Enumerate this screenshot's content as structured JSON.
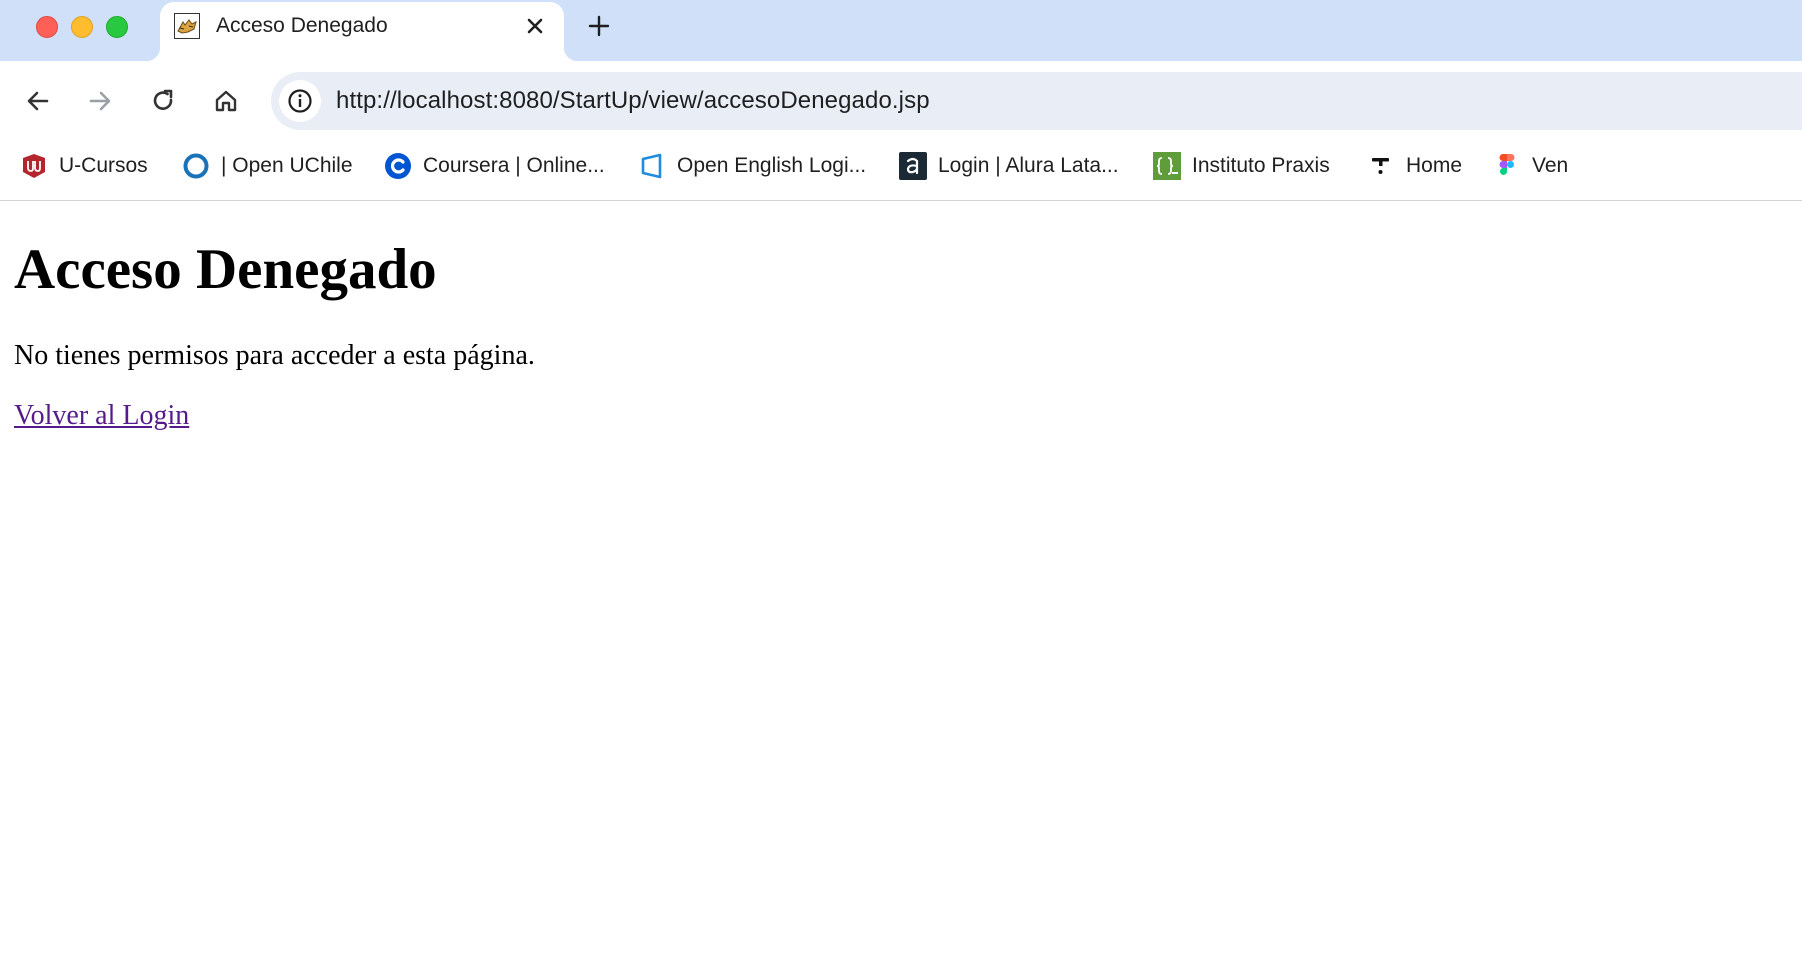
{
  "browser": {
    "tab": {
      "title": "Acceso Denegado",
      "favicon": "tomcat-icon"
    },
    "address_bar": {
      "url": "http://localhost:8080/StartUp/view/accesoDenegado.jsp"
    },
    "bookmarks": [
      {
        "label": "U-Cursos",
        "icon": "u-cursos-icon"
      },
      {
        "label": "| Open UChile",
        "icon": "open-uchile-icon"
      },
      {
        "label": "Coursera | Online...",
        "icon": "coursera-icon"
      },
      {
        "label": "Open English Logi...",
        "icon": "open-english-icon"
      },
      {
        "label": "Login | Alura Lata...",
        "icon": "alura-icon"
      },
      {
        "label": "Instituto Praxis",
        "icon": "praxis-icon"
      },
      {
        "label": "Home",
        "icon": "home-bookmark-icon"
      },
      {
        "label": "Ven",
        "icon": "figma-icon"
      }
    ],
    "colors": {
      "tabstrip": "#cfe0f8",
      "omnibox": "#e9eef6"
    }
  },
  "page": {
    "heading": "Acceso Denegado",
    "message": "No tienes permisos para acceder a esta página.",
    "link_label": "Volver al Login",
    "link_color": "#551a8b"
  }
}
